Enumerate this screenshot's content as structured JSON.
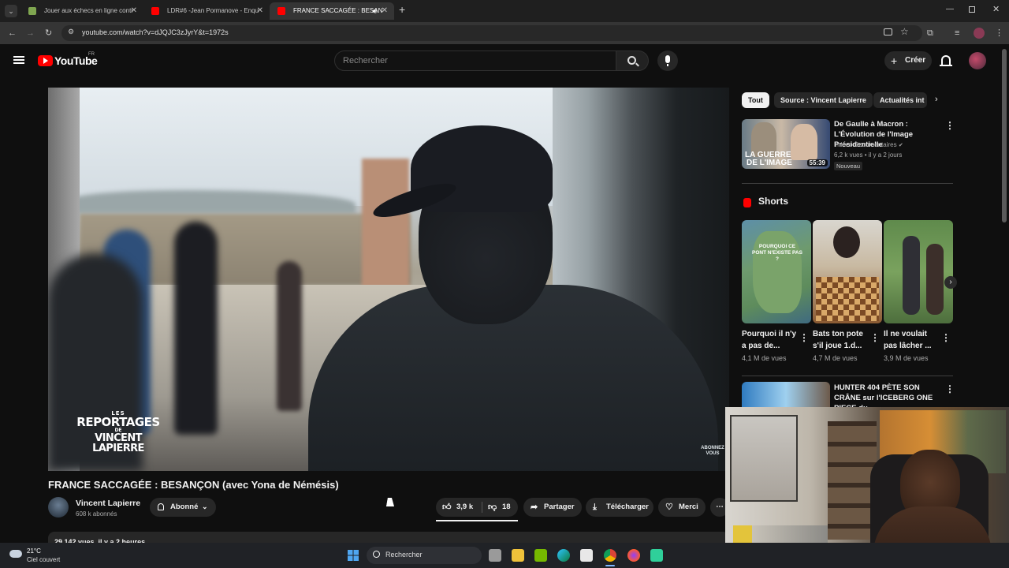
{
  "browser": {
    "tabs": [
      {
        "title": "Jouer aux échecs en ligne contr",
        "active": false
      },
      {
        "title": "LDR#6 -Jean Pormanove - Enqu",
        "active": false
      },
      {
        "title": "FRANCE SACCAGÉE : BESAN",
        "active": true
      }
    ],
    "new_tab_label": "+",
    "url": "youtube.com/watch?v=dJQJC3zJyrY&t=1972s"
  },
  "youtube": {
    "logo_text": "YouTube",
    "country_code": "FR",
    "search_placeholder": "Rechercher",
    "create_label": "Créer"
  },
  "video": {
    "watermark_line1": "LES",
    "watermark_line2": "REPORTAGES",
    "watermark_line3": "DE",
    "watermark_line4": "VINCENT LAPIERRE",
    "corner_badge": "ABONNEZ VOUS",
    "title": "FRANCE SACCAGÉE : BESANÇON (avec Yona de Némésis)",
    "channel_name": "Vincent Lapierre",
    "subscribers": "608 k abonnés",
    "subscribe_label": "Abonné",
    "likes": "3,9 k",
    "dislikes": "18",
    "share_label": "Partager",
    "download_label": "Télécharger",
    "thanks_label": "Merci",
    "views_date": "29 142 vues  il y a 2 heures"
  },
  "sidebar": {
    "chips": [
      "Tout",
      "Source : Vincent Lapierre",
      "Actualités int"
    ],
    "recommended": [
      {
        "title": "De Gaulle à Macron : L'Évolution de l'Image Présidentielle",
        "channel": "imineo Documentaires",
        "meta": "6,2 k vues • il y a 2 jours",
        "badge": "Nouveau",
        "duration": "55:39",
        "thumb_text1": "LA GUERRE",
        "thumb_text2": "DE L'IMAGE"
      }
    ],
    "shorts_title": "Shorts",
    "shorts": [
      {
        "title": "Pourquoi il n'y a pas de...",
        "views": "4,1 M de vues",
        "thumb_text": "POURQUOI CE PONT N'EXISTE PAS ?"
      },
      {
        "title": "Bats ton pote s'il joue 1.d...",
        "views": "4,7 M de vues"
      },
      {
        "title": "Il ne voulait pas lâcher ...",
        "views": "3,9 M de vues"
      }
    ],
    "next_video": {
      "title": "HUNTER 404 PÈTE SON CRÂNE sur l'ICEBERG ONE PIECE du ..."
    }
  },
  "taskbar": {
    "weather_temp": "21°C",
    "weather_desc": "Ciel couvert",
    "search_label": "Rechercher"
  },
  "colors": {
    "youtube_red": "#ff0000",
    "background": "#0f0f0f",
    "surface": "#272727"
  }
}
